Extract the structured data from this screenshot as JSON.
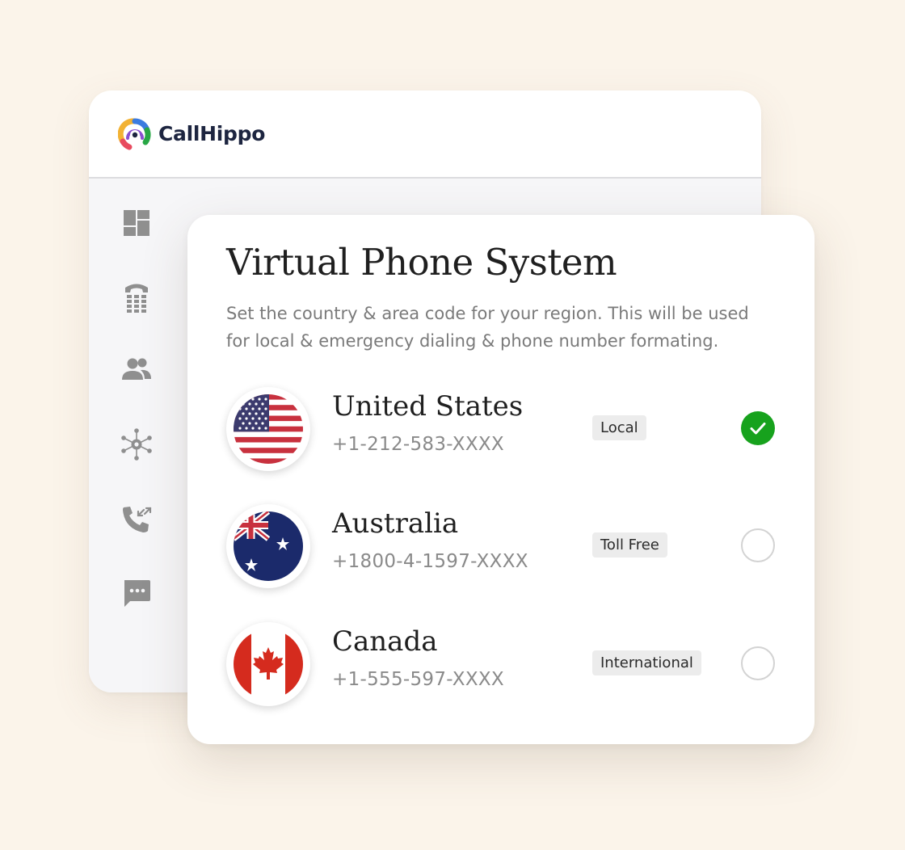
{
  "brand": {
    "name": "CallHippo"
  },
  "sidebar": {
    "items": [
      {
        "icon": "dashboard-icon"
      },
      {
        "icon": "dialpad-icon"
      },
      {
        "icon": "contacts-icon"
      },
      {
        "icon": "integrations-icon"
      },
      {
        "icon": "call-logs-icon"
      },
      {
        "icon": "messages-icon"
      }
    ]
  },
  "card": {
    "title": "Virtual Phone System",
    "subtitle": "Set the country & area code for your region. This will be used for local & emergency dialing & phone number formating."
  },
  "countries": [
    {
      "name": "United States",
      "number": "+1-212-583-XXXX",
      "type": "Local",
      "selected": true,
      "flag": "us-flag-icon"
    },
    {
      "name": "Australia",
      "number": "+1800-4-1597-XXXX",
      "type": "Toll Free",
      "selected": false,
      "flag": "au-flag-icon"
    },
    {
      "name": "Canada",
      "number": "+1-555-597-XXXX",
      "type": "International",
      "selected": false,
      "flag": "ca-flag-icon"
    }
  ],
  "colors": {
    "background": "#fbf4ea",
    "selected": "#17a21d",
    "icon_gray": "#8f8f8f",
    "brand_text": "#1d2540"
  }
}
